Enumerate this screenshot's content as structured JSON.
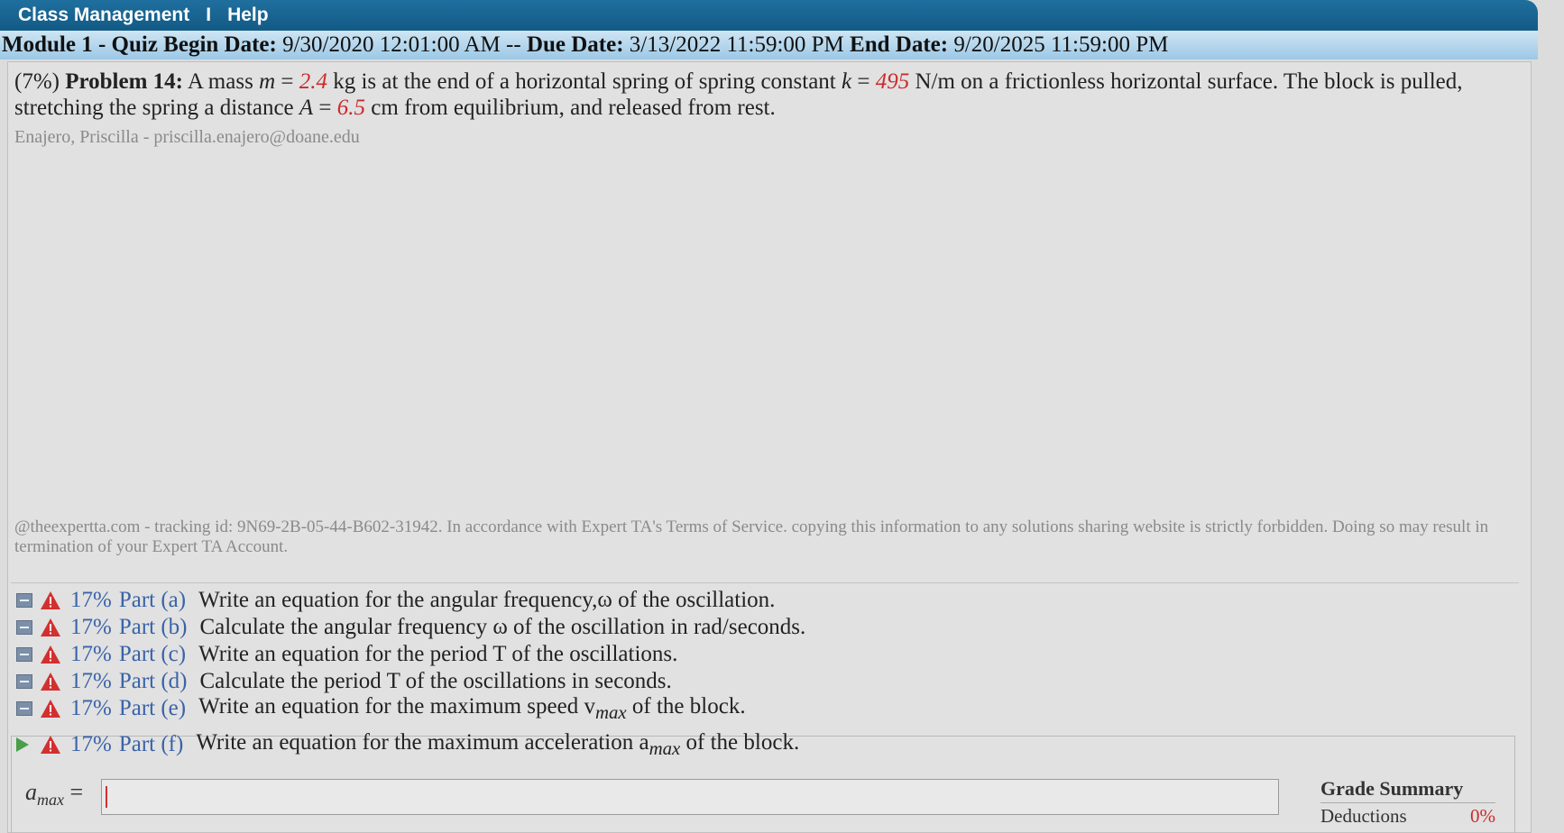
{
  "nav": {
    "class_management": "Class Management",
    "separator": "I",
    "help": "Help"
  },
  "module": {
    "name": "Module 1 - Quiz",
    "begin_label": "Begin Date:",
    "begin_value": "9/30/2020 12:01:00 AM",
    "dash": "--",
    "due_label": "Due Date:",
    "due_value": "3/13/2022 11:59:00 PM",
    "end_label": "End Date:",
    "end_value": "9/20/2025 11:59:00 PM"
  },
  "problem": {
    "weight": "(7%)",
    "title": "Problem 14:",
    "text_1": "A mass",
    "m_sym": "m",
    "eq": "=",
    "m_val": "2.4",
    "text_2": "kg is at the end of a horizontal spring of spring constant",
    "k_sym": "k",
    "k_val": "495",
    "text_3": "N/m on a frictionless horizontal surface. The block is pulled, stretching the spring a distance",
    "a_sym": "A",
    "a_val": "6.5",
    "text_4": "cm from equilibrium, and released from rest."
  },
  "student": "Enajero, Priscilla - priscilla.enajero@doane.edu",
  "footer_note": "@theexpertta.com - tracking id: 9N69-2B-05-44-B602-31942. In accordance with Expert TA's Terms of Service. copying this information to any solutions sharing website is strictly forbidden. Doing so may result in termination of your Expert TA Account.",
  "parts": [
    {
      "pct": "17%",
      "name": "Part (a)",
      "desc": "Write an equation for the angular frequency,ω of the oscillation."
    },
    {
      "pct": "17%",
      "name": "Part (b)",
      "desc": "Calculate the angular frequency ω of the oscillation in rad/seconds."
    },
    {
      "pct": "17%",
      "name": "Part (c)",
      "desc": "Write an equation for the period T of the oscillations."
    },
    {
      "pct": "17%",
      "name": "Part (d)",
      "desc": "Calculate the period T of the oscillations in seconds."
    },
    {
      "pct": "17%",
      "name": "Part (e)",
      "desc": "Write an equation for the maximum speed v",
      "sub": "max",
      "desc_end": "of the block."
    },
    {
      "pct": "17%",
      "name": "Part (f)",
      "desc": "Write an equation for the maximum acceleration a",
      "sub": "max",
      "desc_end": "of the block."
    }
  ],
  "answer": {
    "label": "a",
    "label_sub": "max",
    "eq": "=",
    "value": ""
  },
  "grade": {
    "title": "Grade Summary",
    "deductions_label": "Deductions",
    "deductions_value": "0%"
  },
  "colors": {
    "accent_blue": "#3a63a8",
    "given_red": "#cc2a2a",
    "nav_bg": "#1f6f9e"
  },
  "icons": {
    "collapsed_part": "minus-box-icon",
    "warning": "warning-triangle-icon",
    "expand": "play-triangle-icon"
  }
}
